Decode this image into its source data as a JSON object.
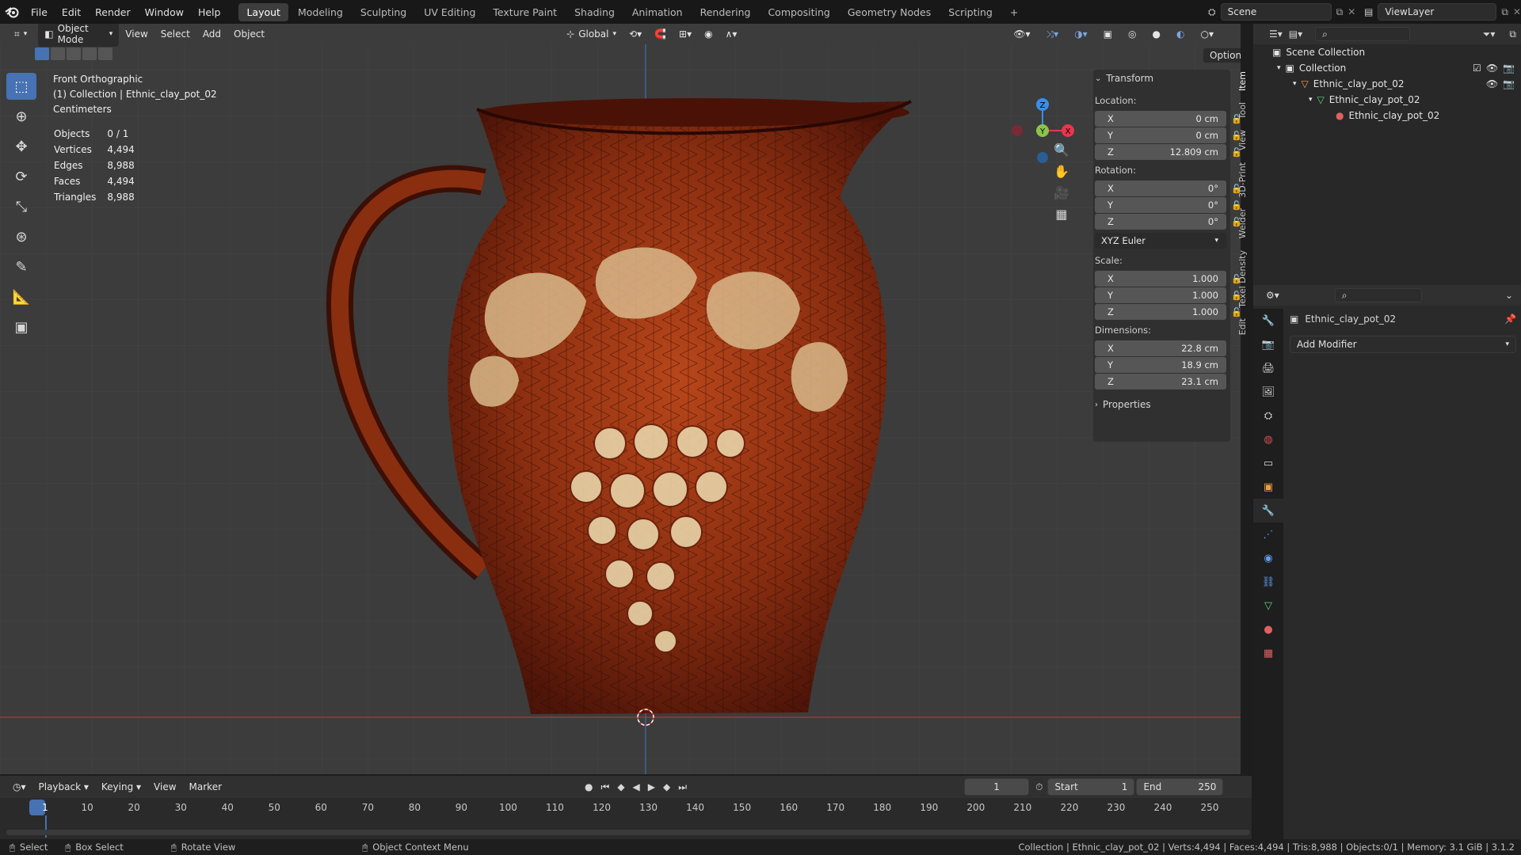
{
  "menubar": {
    "menus": [
      "File",
      "Edit",
      "Render",
      "Window",
      "Help"
    ],
    "workspaces": [
      "Layout",
      "Modeling",
      "Sculpting",
      "UV Editing",
      "Texture Paint",
      "Shading",
      "Animation",
      "Rendering",
      "Compositing",
      "Geometry Nodes",
      "Scripting"
    ],
    "active_workspace": "Layout",
    "add_tab": "+",
    "scene": "Scene",
    "view_layer": "ViewLayer"
  },
  "viewport_header": {
    "mode": "Object Mode",
    "menus": [
      "View",
      "Select",
      "Add",
      "Object"
    ],
    "orientation": "Global",
    "options": "Options"
  },
  "viewport_overlay": {
    "view_name": "Front Orthographic",
    "collection_line": "(1) Collection | Ethnic_clay_pot_02",
    "units": "Centimeters",
    "stats": [
      {
        "label": "Objects",
        "value": "0 / 1"
      },
      {
        "label": "Vertices",
        "value": "4,494"
      },
      {
        "label": "Edges",
        "value": "8,988"
      },
      {
        "label": "Faces",
        "value": "4,494"
      },
      {
        "label": "Triangles",
        "value": "8,988"
      }
    ]
  },
  "gizmo": {
    "z": "Z",
    "y": "Y",
    "x": "X",
    "x_color": "#e2394d",
    "y_color": "#8bc34a",
    "z_color": "#3a8ee6"
  },
  "npanel": {
    "header": "Transform",
    "location_label": "Location:",
    "location": [
      {
        "axis": "X",
        "value": "0 cm"
      },
      {
        "axis": "Y",
        "value": "0 cm"
      },
      {
        "axis": "Z",
        "value": "12.809 cm"
      }
    ],
    "rotation_label": "Rotation:",
    "rotation": [
      {
        "axis": "X",
        "value": "0°"
      },
      {
        "axis": "Y",
        "value": "0°"
      },
      {
        "axis": "Z",
        "value": "0°"
      }
    ],
    "rotation_mode": "XYZ Euler",
    "scale_label": "Scale:",
    "scale": [
      {
        "axis": "X",
        "value": "1.000"
      },
      {
        "axis": "Y",
        "value": "1.000"
      },
      {
        "axis": "Z",
        "value": "1.000"
      }
    ],
    "dimensions_label": "Dimensions:",
    "dimensions": [
      {
        "axis": "X",
        "value": "22.8 cm"
      },
      {
        "axis": "Y",
        "value": "18.9 cm"
      },
      {
        "axis": "Z",
        "value": "23.1 cm"
      }
    ],
    "properties": "Properties",
    "tabs": [
      "Item",
      "Tool",
      "View",
      "3D-Print",
      "Welder",
      "Texel Density",
      "Edit"
    ]
  },
  "outliner": {
    "rows": [
      "Scene Collection",
      "Collection",
      "Ethnic_clay_pot_02",
      "Ethnic_clay_pot_02",
      "Ethnic_clay_pot_02"
    ]
  },
  "properties": {
    "object_name": "Ethnic_clay_pot_02",
    "add_modifier": "Add Modifier"
  },
  "timeline": {
    "menus": [
      "Playback",
      "Keying",
      "View",
      "Marker"
    ],
    "current_frame": "1",
    "start_label": "Start",
    "start": "1",
    "end_label": "End",
    "end": "250",
    "ticks": [
      "1",
      "10",
      "20",
      "30",
      "40",
      "50",
      "60",
      "70",
      "80",
      "90",
      "100",
      "110",
      "120",
      "130",
      "140",
      "150",
      "160",
      "170",
      "180",
      "190",
      "200",
      "210",
      "220",
      "230",
      "240",
      "250"
    ]
  },
  "statusbar": {
    "select": "Select",
    "box_select": "Box Select",
    "rotate_view": "Rotate View",
    "context_menu": "Object Context Menu",
    "info": "Collection | Ethnic_clay_pot_02 | Verts:4,494 | Faces:4,494 | Tris:8,988 | Objects:0/1 | Memory: 3.1 GiB | 3.1.2"
  },
  "colors": {
    "accent": "#4772b3",
    "pot_dark": "#5a1a0c",
    "pot_mid": "#9c3512",
    "glaze_light": "#e8d3a8"
  }
}
